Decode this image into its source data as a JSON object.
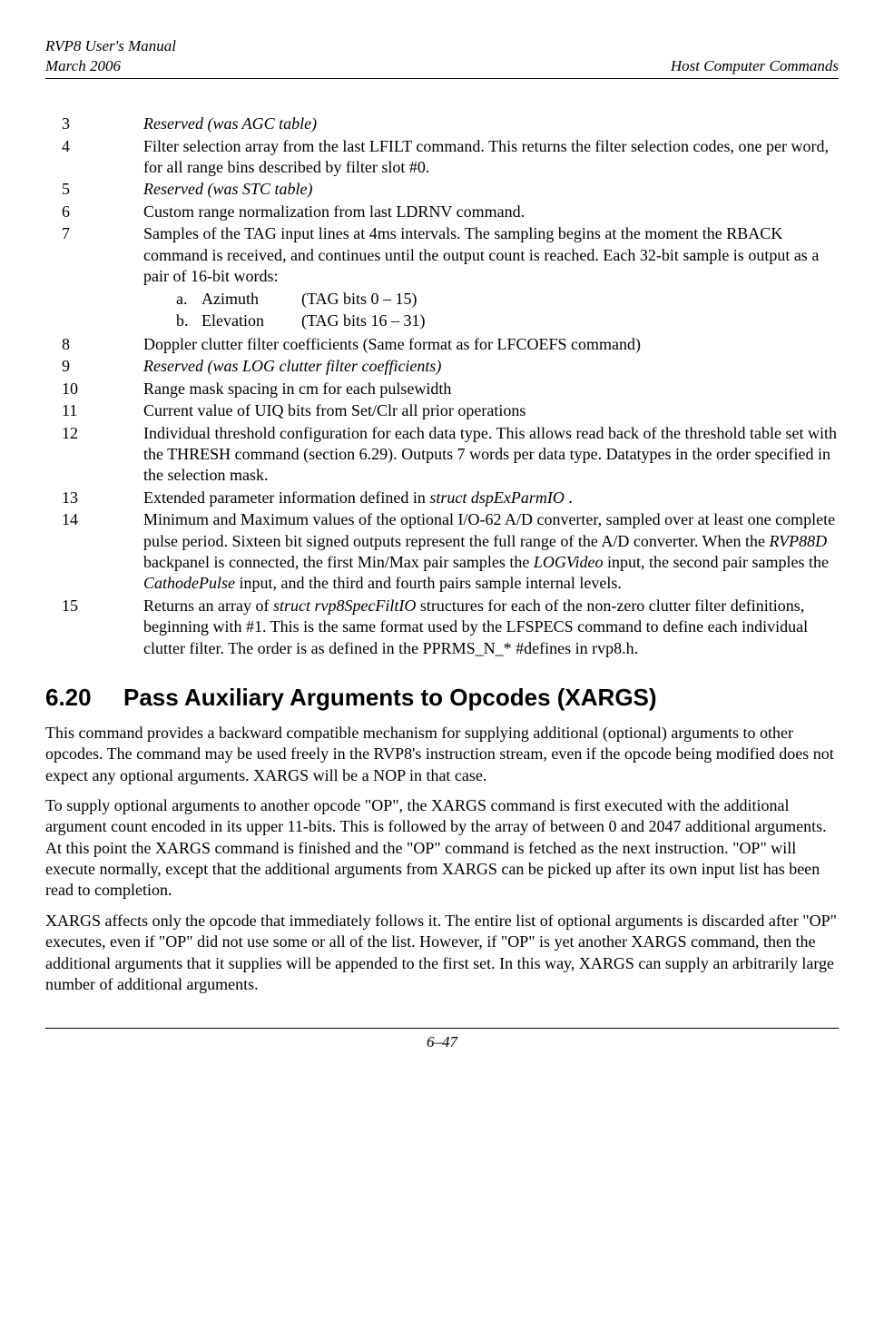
{
  "header": {
    "left_line1": "RVP8 User's Manual",
    "left_line2": "March 2006",
    "right": "Host Computer Commands"
  },
  "items": [
    {
      "num": "3",
      "text": "Reserved (was AGC table)",
      "italic": true
    },
    {
      "num": "4",
      "text": "Filter selection array from the last LFILT command.  This returns the filter selection codes, one per word, for all range bins described by filter slot #0."
    },
    {
      "num": "5",
      "text": "Reserved (was STC table)",
      "italic": true
    },
    {
      "num": "6",
      "text": "Custom range normalization from last LDRNV command."
    },
    {
      "num": "7",
      "text": "Samples of the TAG input lines at 4ms intervals.  The sampling begins at the moment the RBACK command is received, and continues until the output count is reached.  Each 32-bit sample is output as a pair of 16-bit words:",
      "sub": [
        {
          "label": "a.",
          "name": "Azimuth",
          "tag": "(TAG bits 0 – 15)"
        },
        {
          "label": "b.",
          "name": "Elevation",
          "tag": "(TAG bits 16 – 31)"
        }
      ]
    },
    {
      "num": "8",
      "text": "Doppler clutter filter coefficients (Same format as for LFCOEFS command)"
    },
    {
      "num": "9",
      "text": "Reserved (was LOG clutter filter coefficients)",
      "italic": true
    },
    {
      "num": "10",
      "text": "Range mask spacing in cm for each pulsewidth"
    },
    {
      "num": "11",
      "text": "Current value of UIQ bits from Set/Clr all prior operations"
    },
    {
      "num": "12",
      "text": "Individual threshold configuration for each data type.  This allows read back of the threshold table set with the THRESH command (section 6.29).  Outputs 7 words per data type.  Datatypes in the order specified in the selection mask."
    },
    {
      "num": "13",
      "text_html": "Extended parameter information defined in <span class=\"italic\">struct dspExParmIO</span> ."
    },
    {
      "num": "14",
      "text_html": "Minimum and Maximum values of the optional I/O-62 A/D converter, sampled over at least one complete pulse period.  Sixteen bit signed outputs represent the full range of the A/D converter.  When the <span class=\"italic\">RVP88D</span> backpanel is connected, the first Min/Max pair samples the <span class=\"italic\">LOGVideo</span> input, the second pair samples the <span class=\"italic\">CathodePulse</span> input, and the third and fourth pairs sample internal levels."
    },
    {
      "num": "15",
      "text_html": "Returns an array of  <span class=\"italic\">struct rvp8SpecFiltIO</span>  structures for each of the non-zero clutter filter definitions, beginning with #1.  This is the same format used by the LFSPECS command to define each individual clutter filter.  The order is as defined in the PPRMS_N_* #defines in rvp8.h."
    }
  ],
  "section": {
    "num": "6.20",
    "title": "Pass Auxiliary Arguments to Opcodes (XARGS)"
  },
  "paras": [
    "This command provides a backward compatible mechanism for supplying additional (optional) arguments to other opcodes.  The command may be used freely in the RVP8's instruction stream, even if the opcode being modified does not expect any optional arguments.  XARGS will be a NOP in that case.",
    "To supply optional arguments to another opcode \"OP\", the XARGS command is first executed with the additional argument count encoded in its upper 11-bits.  This is followed by the array of between 0 and 2047 additional arguments.  At this point the XARGS command is finished and the \"OP\" command is fetched as the next instruction.  \"OP\" will execute normally, except that the additional arguments from XARGS can be picked up after its own input list has been read to completion.",
    "XARGS affects only the opcode that immediately follows it.  The entire list of optional arguments is discarded after \"OP\" executes, even if \"OP\" did not use some or all of the list.  However, if \"OP\" is yet another XARGS command, then the additional arguments that it supplies will be appended to the first set.  In this way, XARGS can supply an arbitrarily large number of additional arguments."
  ],
  "footer": "6–47"
}
